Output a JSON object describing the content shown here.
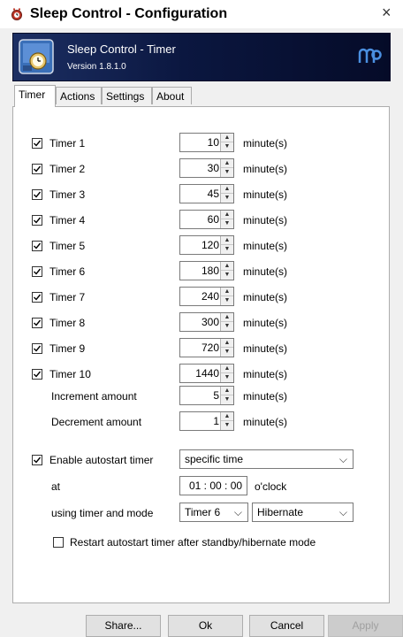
{
  "window": {
    "title": "Sleep Control - Configuration",
    "close_glyph": "×"
  },
  "banner": {
    "title": "Sleep Control - Timer",
    "version": "Version 1.8.1.0",
    "logo_icon": "mp-logo-icon",
    "app_icon": "app-icon"
  },
  "tabs": [
    "Timer",
    "Actions",
    "Settings",
    "About"
  ],
  "active_tab": "Timer",
  "timers": [
    {
      "label": "Timer 1",
      "checked": true,
      "value": "10",
      "unit": "minute(s)"
    },
    {
      "label": "Timer 2",
      "checked": true,
      "value": "30",
      "unit": "minute(s)"
    },
    {
      "label": "Timer 3",
      "checked": true,
      "value": "45",
      "unit": "minute(s)"
    },
    {
      "label": "Timer 4",
      "checked": true,
      "value": "60",
      "unit": "minute(s)"
    },
    {
      "label": "Timer 5",
      "checked": true,
      "value": "120",
      "unit": "minute(s)"
    },
    {
      "label": "Timer 6",
      "checked": true,
      "value": "180",
      "unit": "minute(s)"
    },
    {
      "label": "Timer 7",
      "checked": true,
      "value": "240",
      "unit": "minute(s)"
    },
    {
      "label": "Timer 8",
      "checked": true,
      "value": "300",
      "unit": "minute(s)"
    },
    {
      "label": "Timer 9",
      "checked": true,
      "value": "720",
      "unit": "minute(s)"
    },
    {
      "label": "Timer 10",
      "checked": true,
      "value": "1440",
      "unit": "minute(s)"
    }
  ],
  "increment": {
    "label": "Increment amount",
    "value": "5",
    "unit": "minute(s)"
  },
  "decrement": {
    "label": "Decrement amount",
    "value": "1",
    "unit": "minute(s)"
  },
  "autostart": {
    "enable_label": "Enable autostart timer",
    "enabled": true,
    "mode_value": "specific time",
    "at_label": "at",
    "time_value": "01 : 00 : 00",
    "time_suffix": "o'clock",
    "using_label": "using timer and mode",
    "timer_value": "Timer 6",
    "power_mode_value": "Hibernate",
    "restart_label": "Restart autostart timer after standby/hibernate mode",
    "restart_checked": false
  },
  "buttons": {
    "share": "Share...",
    "ok": "Ok",
    "cancel": "Cancel",
    "apply": "Apply"
  },
  "colors": {
    "banner": "#0b1740",
    "accent_logo": "#4a8fe0"
  }
}
